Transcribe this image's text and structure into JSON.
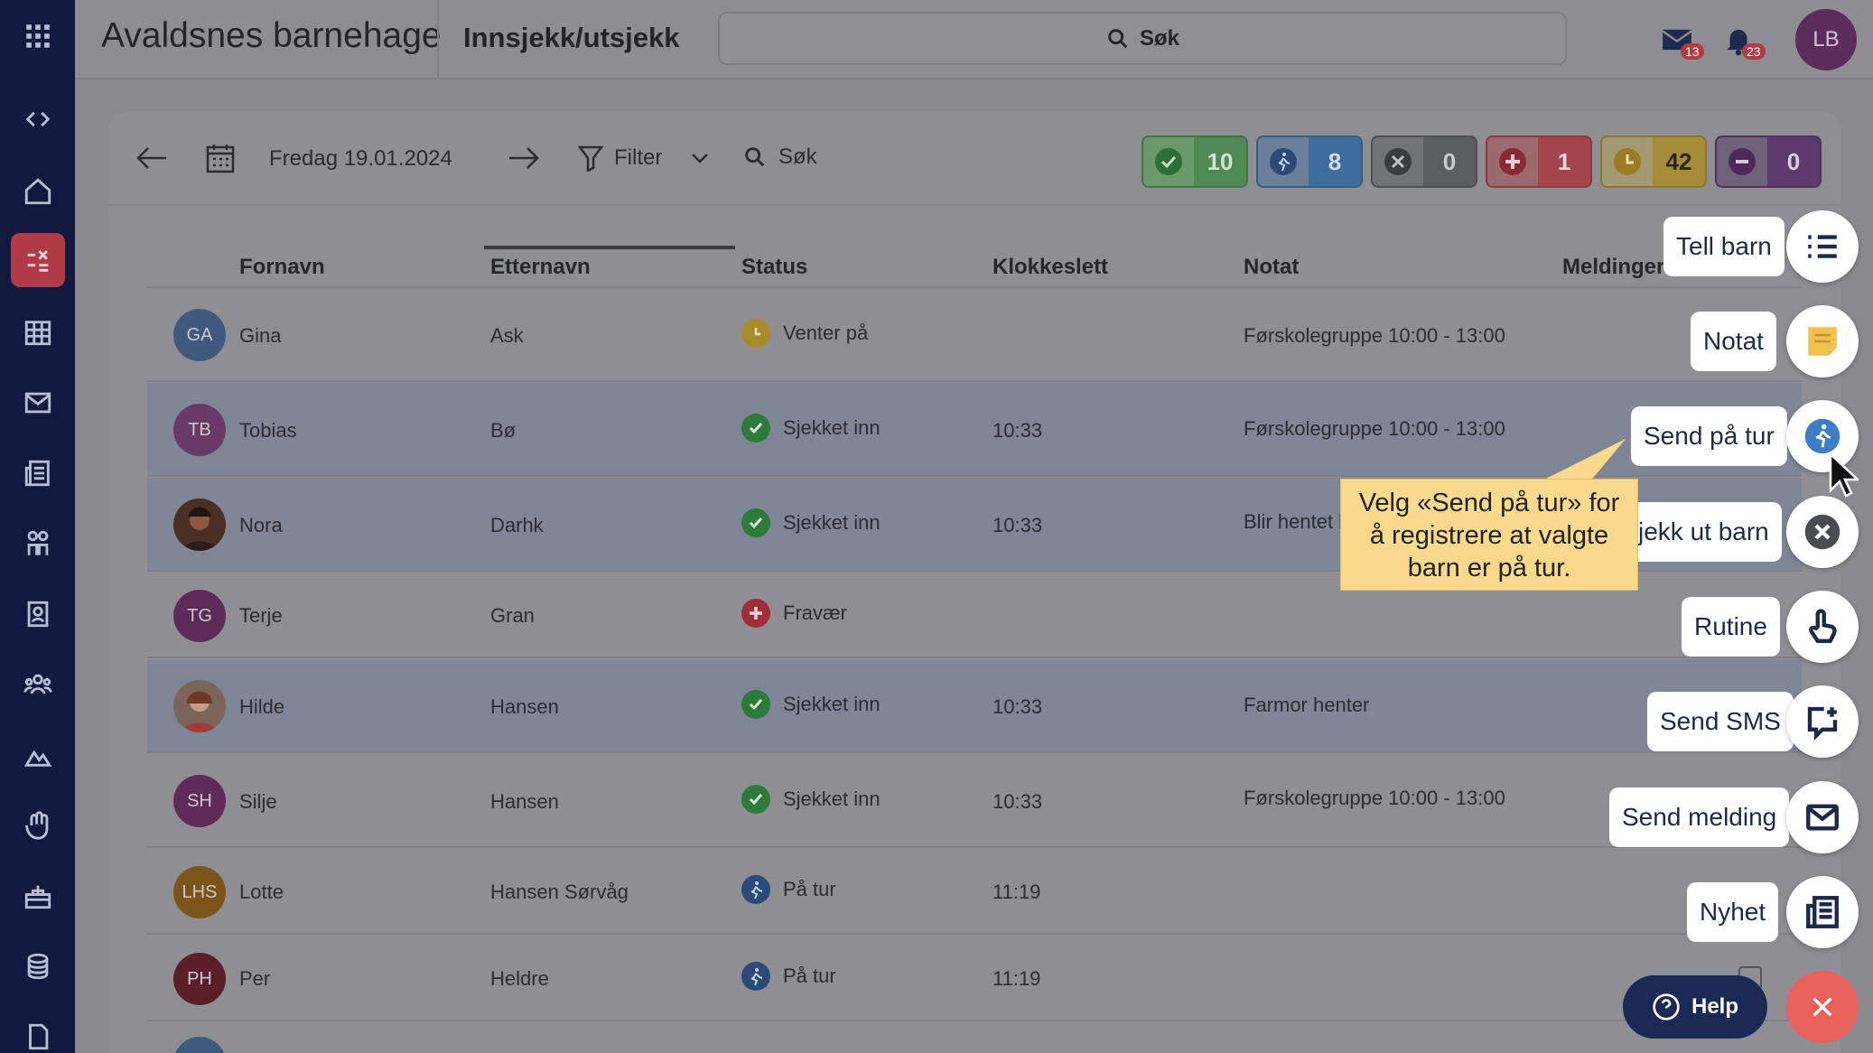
{
  "header": {
    "org_name": "Avaldsnes barnehage",
    "page_title": "Innsjekk/utsjekk",
    "search_label": "Søk",
    "mail_badge": "13",
    "notif_badge": "23",
    "user_initials": "LB"
  },
  "toolbar": {
    "date": "Fredag 19.01.2024",
    "filter_label": "Filter",
    "search_label": "Søk",
    "stats": [
      {
        "name": "checked-in",
        "count": "10",
        "color": "#4f8a55"
      },
      {
        "name": "on-trip",
        "count": "8",
        "color": "#3f6e9c"
      },
      {
        "name": "checked-out",
        "count": "0",
        "color": "#5b5d62"
      },
      {
        "name": "absent",
        "count": "1",
        "color": "#b03a45"
      },
      {
        "name": "waiting",
        "count": "42",
        "color": "#b09330"
      },
      {
        "name": "not-coming",
        "count": "0",
        "color": "#5b3a6d"
      }
    ]
  },
  "table": {
    "headers": [
      "Fornavn",
      "Etternavn",
      "Status",
      "Klokkeslett",
      "Notat",
      "Meldinger"
    ],
    "rows": [
      {
        "initials": "GA",
        "first": "Gina",
        "last": "Ask",
        "status": "Venter på",
        "time": "",
        "note": "Førskolegruppe 10:00 - 13:00"
      },
      {
        "initials": "TB",
        "first": "Tobias",
        "last": "Bø",
        "status": "Sjekket inn",
        "time": "10:33",
        "note": "Førskolegruppe 10:00 - 13:00"
      },
      {
        "initials": "",
        "first": "Nora",
        "last": "Darhk",
        "status": "Sjekket inn",
        "time": "10:33",
        "note": "Blir hentet k"
      },
      {
        "initials": "TG",
        "first": "Terje",
        "last": "Gran",
        "status": "Fravær",
        "time": "",
        "note": ""
      },
      {
        "initials": "",
        "first": "Hilde",
        "last": "Hansen",
        "status": "Sjekket inn",
        "time": "10:33",
        "note": "Farmor henter"
      },
      {
        "initials": "SH",
        "first": "Silje",
        "last": "Hansen",
        "status": "Sjekket inn",
        "time": "10:33",
        "note": "Førskolegruppe 10:00 - 13:00"
      },
      {
        "initials": "LHS",
        "first": "Lotte",
        "last": "Hansen Sørvåg",
        "status": "På tur",
        "time": "11:19",
        "note": ""
      },
      {
        "initials": "PH",
        "first": "Per",
        "last": "Heldre",
        "status": "På tur",
        "time": "11:19",
        "note": ""
      }
    ]
  },
  "actions": {
    "count_children": "Tell barn",
    "note": "Notat",
    "send_on_trip": "Send på tur",
    "check_out": "jekk ut barn",
    "routine": "Rutine",
    "send_sms": "Send SMS",
    "send_message": "Send melding",
    "news": "Nyhet"
  },
  "tooltip": {
    "line1": "Velg «Send på tur» for",
    "line2": "å registrere at valgte",
    "line3": "barn er på tur."
  },
  "help_label": "Help"
}
